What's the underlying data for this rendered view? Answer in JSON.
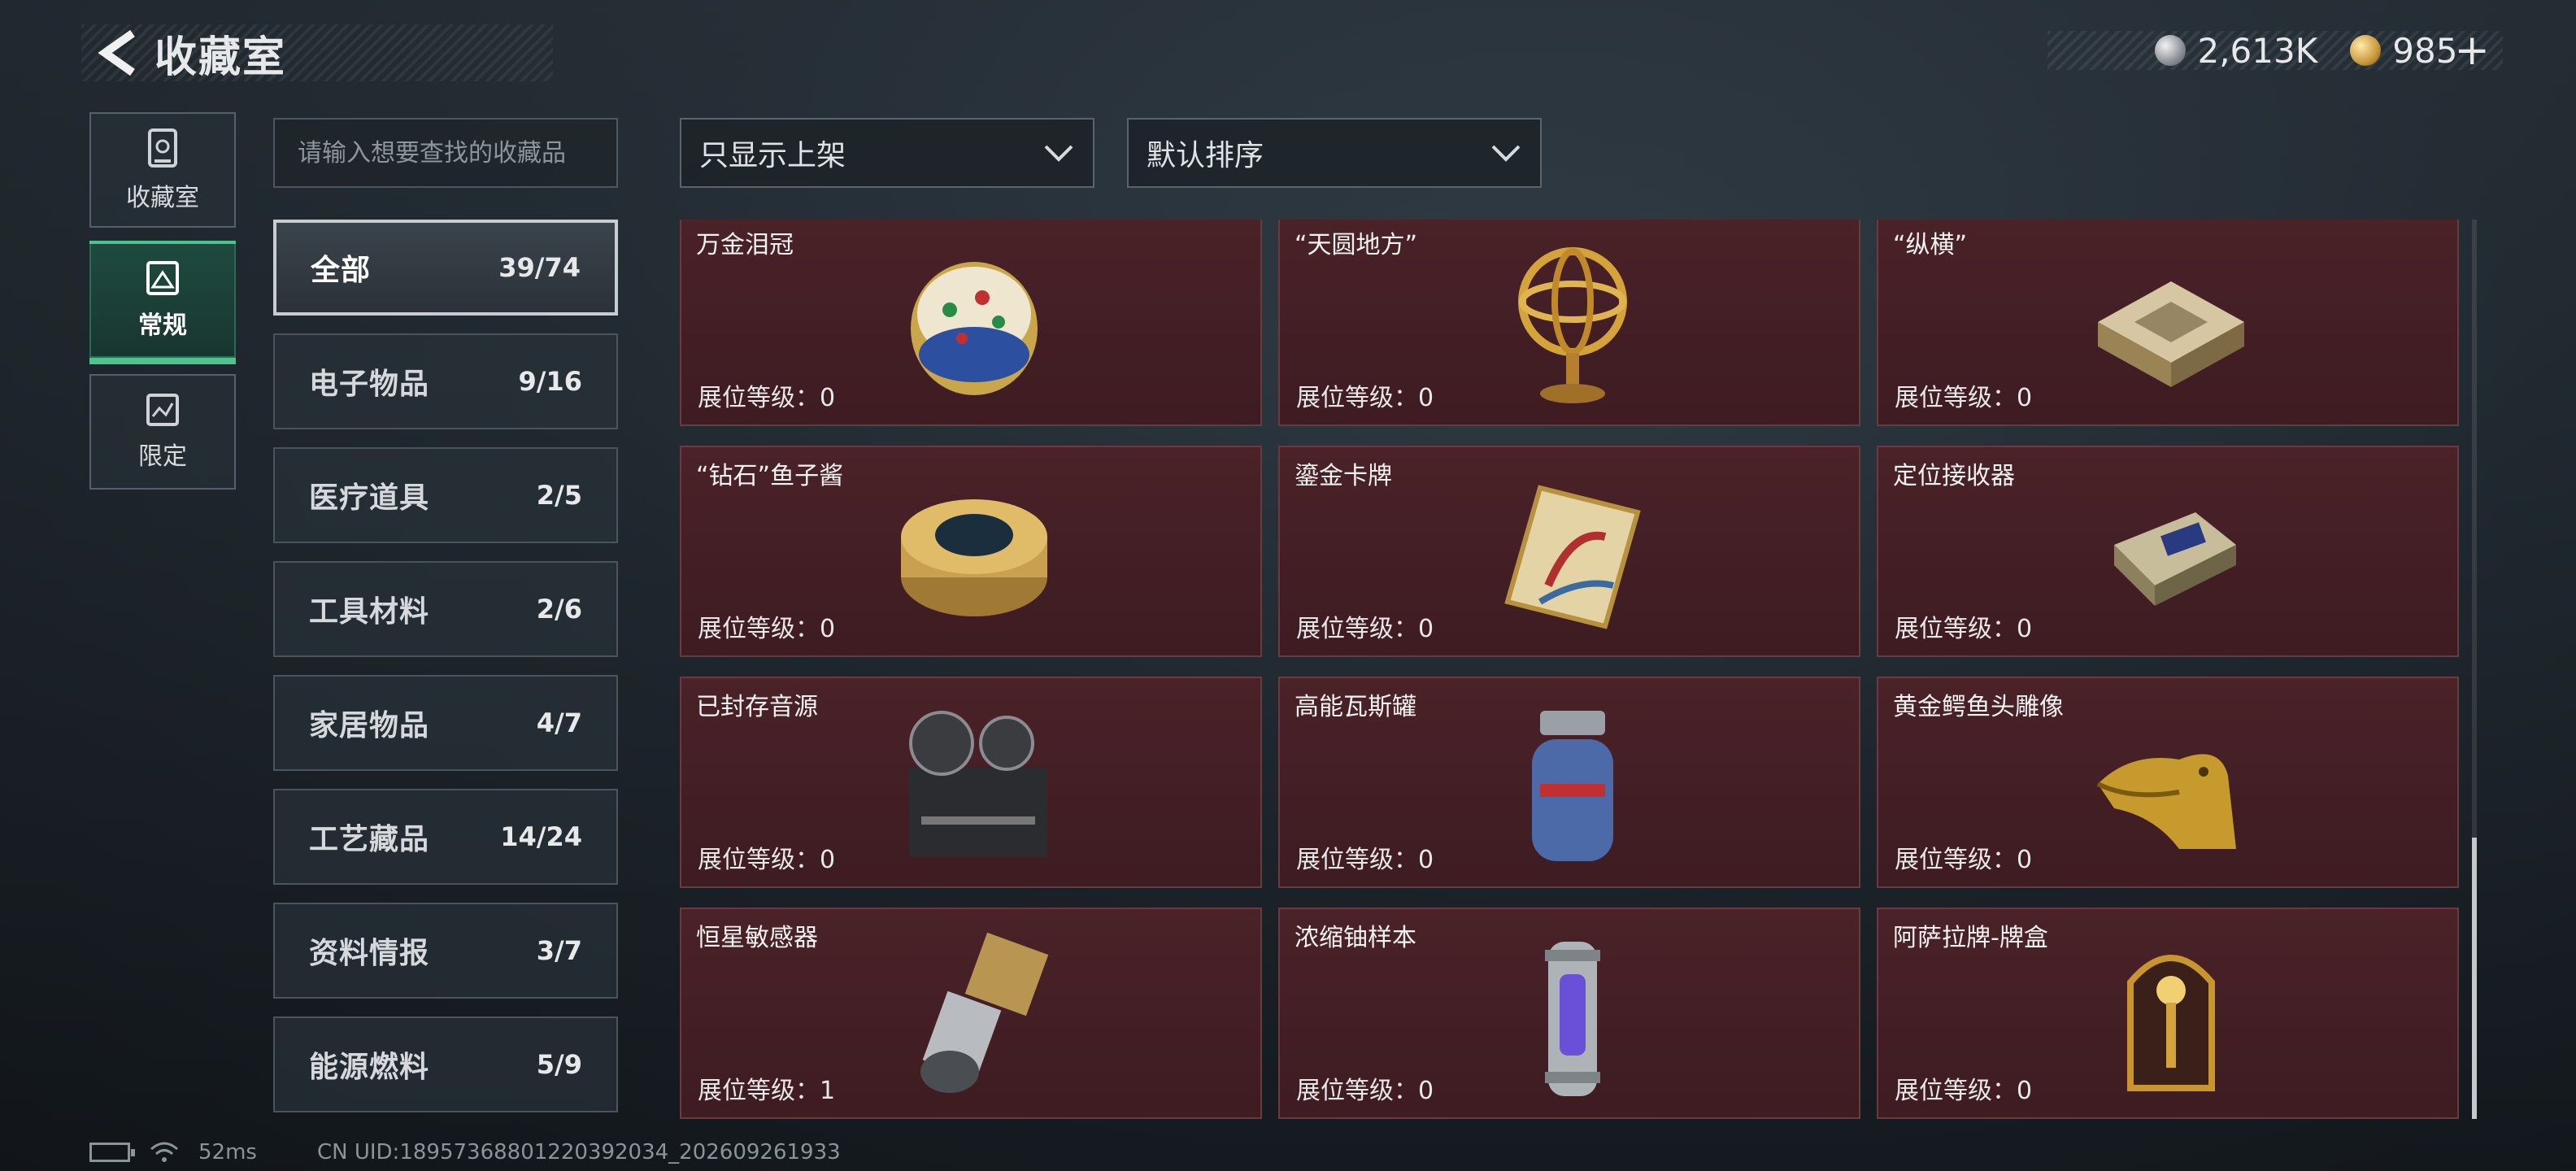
{
  "header": {
    "title": "收藏室",
    "currency_silver": "2,613K",
    "currency_gold": "985",
    "add_label": "+"
  },
  "side_nav": [
    {
      "label": "收藏室",
      "icon": "vault-icon"
    },
    {
      "label": "常规",
      "icon": "image-icon"
    },
    {
      "label": "限定",
      "icon": "limited-icon"
    }
  ],
  "search": {
    "placeholder": "请输入想要查找的收藏品"
  },
  "filters": {
    "shelf_filter": "只显示上架",
    "sort": "默认排序"
  },
  "categories": [
    {
      "name": "全部",
      "count": "39/74"
    },
    {
      "name": "电子物品",
      "count": "9/16"
    },
    {
      "name": "医疗道具",
      "count": "2/5"
    },
    {
      "name": "工具材料",
      "count": "2/6"
    },
    {
      "name": "家居物品",
      "count": "4/7"
    },
    {
      "name": "工艺藏品",
      "count": "14/24"
    },
    {
      "name": "资料情报",
      "count": "3/7"
    },
    {
      "name": "能源燃料",
      "count": "5/9"
    }
  ],
  "items": [
    {
      "name": "万金泪冠",
      "level": "展位等级：0",
      "icon": "jeweled-egg-icon"
    },
    {
      "name": "“天圆地方”",
      "level": "展位等级：0",
      "icon": "armillary-sphere-icon"
    },
    {
      "name": "“纵横”",
      "level": "展位等级：0",
      "icon": "chessboard-icon"
    },
    {
      "name": "“钻石”鱼子酱",
      "level": "展位等级：0",
      "icon": "caviar-tin-icon"
    },
    {
      "name": "鎏金卡牌",
      "level": "展位等级：0",
      "icon": "gold-card-icon"
    },
    {
      "name": "定位接收器",
      "level": "展位等级：0",
      "icon": "receiver-icon"
    },
    {
      "name": "已封存音源",
      "level": "展位等级：0",
      "icon": "reel-recorder-icon"
    },
    {
      "name": "高能瓦斯罐",
      "level": "展位等级：0",
      "icon": "gas-canister-icon"
    },
    {
      "name": "黄金鳄鱼头雕像",
      "level": "展位等级：0",
      "icon": "gold-crocodile-icon"
    },
    {
      "name": "恒星敏感器",
      "level": "展位等级：1",
      "icon": "star-sensor-icon"
    },
    {
      "name": "浓缩铀样本",
      "level": "展位等级：0",
      "icon": "uranium-capsule-icon"
    },
    {
      "name": "阿萨拉牌-牌盒",
      "level": "展位等级：0",
      "icon": "card-box-icon"
    }
  ],
  "footer": {
    "ping": "52ms",
    "uid": "CN UID:18957368801220392034_202609261933"
  },
  "colors": {
    "card_bg": "#4a2228",
    "accent_green": "#4ec38d",
    "active_border": "#c8cdd2"
  }
}
